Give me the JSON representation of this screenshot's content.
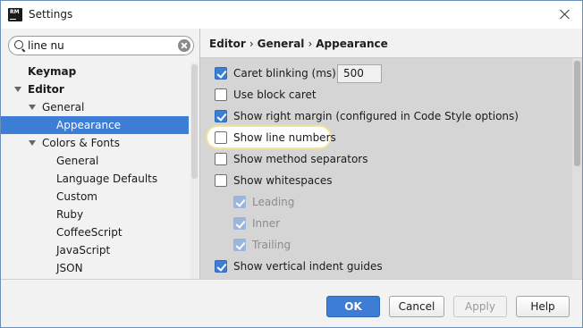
{
  "window": {
    "title": "Settings",
    "app_icon_text": "RM"
  },
  "search": {
    "value": "line nu"
  },
  "tree": {
    "items": [
      {
        "label": "Keymap",
        "bold": true,
        "arrow": false,
        "level": 0
      },
      {
        "label": "Editor",
        "bold": true,
        "arrow": true,
        "level": 0
      },
      {
        "label": "General",
        "bold": false,
        "arrow": true,
        "level": 1
      },
      {
        "label": "Appearance",
        "bold": false,
        "arrow": false,
        "level": 2,
        "selected": true
      },
      {
        "label": "Colors & Fonts",
        "bold": false,
        "arrow": true,
        "level": 1
      },
      {
        "label": "General",
        "bold": false,
        "arrow": false,
        "level": 2
      },
      {
        "label": "Language Defaults",
        "bold": false,
        "arrow": false,
        "level": 2
      },
      {
        "label": "Custom",
        "bold": false,
        "arrow": false,
        "level": 2
      },
      {
        "label": "Ruby",
        "bold": false,
        "arrow": false,
        "level": 2
      },
      {
        "label": "CoffeeScript",
        "bold": false,
        "arrow": false,
        "level": 2
      },
      {
        "label": "JavaScript",
        "bold": false,
        "arrow": false,
        "level": 2
      },
      {
        "label": "JSON",
        "bold": false,
        "arrow": false,
        "level": 2
      }
    ]
  },
  "breadcrumb": {
    "part1": "Editor",
    "part2": "General",
    "part3": "Appearance",
    "separator": "›"
  },
  "options": {
    "caret_blinking": {
      "label": "Caret blinking (ms):",
      "checked": true,
      "value": "500"
    },
    "block_caret": {
      "label": "Use block caret",
      "checked": false
    },
    "right_margin": {
      "label": "Show right margin (configured in Code Style options)",
      "checked": true
    },
    "line_numbers": {
      "label": "Show line numbers",
      "checked": false
    },
    "method_separators": {
      "label": "Show method separators",
      "checked": false
    },
    "whitespaces": {
      "label": "Show whitespaces",
      "checked": false
    },
    "leading": {
      "label": "Leading",
      "checked": true,
      "disabled": true
    },
    "inner": {
      "label": "Inner",
      "checked": true,
      "disabled": true
    },
    "trailing": {
      "label": "Trailing",
      "checked": true,
      "disabled": true
    },
    "indent_guides": {
      "label": "Show vertical indent guides",
      "checked": true
    }
  },
  "buttons": {
    "ok": "OK",
    "cancel": "Cancel",
    "apply": "Apply",
    "help": "Help"
  },
  "colors": {
    "accent": "#3d7dd6",
    "highlight_ring": "#f4e19c",
    "content_bg": "#d5d5d5"
  }
}
